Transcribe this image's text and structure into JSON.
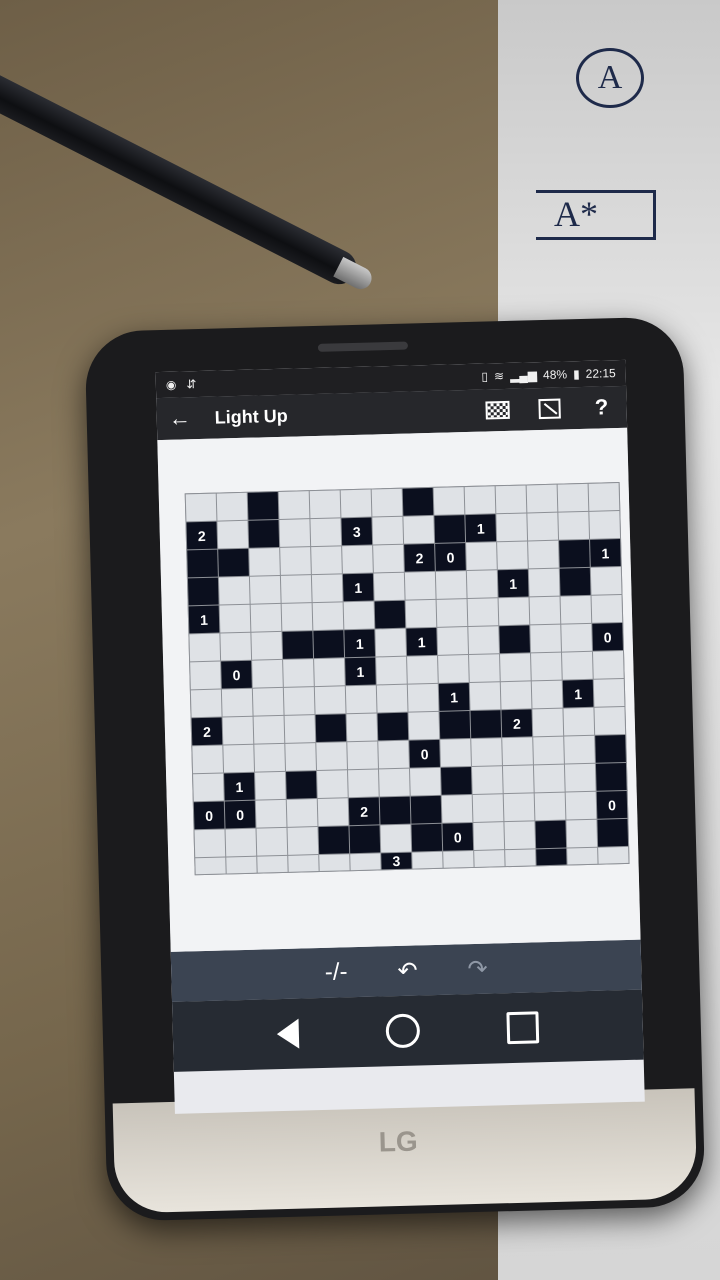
{
  "statusbar": {
    "battery": "48%",
    "time": "22:15"
  },
  "appbar": {
    "title": "Light Up"
  },
  "icons": {
    "back": "arrow-left-icon",
    "pattern": "checkerboard-icon",
    "resize": "resize-icon",
    "help": "help-icon",
    "mark": "mark-icon",
    "undo": "undo-icon",
    "redo": "redo-icon"
  },
  "toolbar": {
    "mark": "-/-",
    "undo": "↶",
    "redo": "↷"
  },
  "background": {
    "paper_top_label": "A",
    "paper_label": "A*"
  },
  "phone": {
    "brand": "LG"
  },
  "board": {
    "cols": 14,
    "rows": 13,
    "grid": [
      [
        ".",
        ".",
        "B",
        ".",
        ".",
        ".",
        ".",
        "B",
        ".",
        ".",
        ".",
        ".",
        ".",
        "."
      ],
      [
        "2",
        ".",
        "B",
        ".",
        ".",
        "3",
        ".",
        ".",
        "B",
        "1",
        ".",
        ".",
        ".",
        "."
      ],
      [
        "B",
        "B",
        ".",
        ".",
        ".",
        ".",
        ".",
        "2",
        "0",
        ".",
        ".",
        ".",
        "B",
        "1"
      ],
      [
        "B",
        ".",
        ".",
        ".",
        ".",
        "1",
        ".",
        ".",
        ".",
        ".",
        "1",
        ".",
        "B",
        "."
      ],
      [
        "1",
        ".",
        ".",
        ".",
        ".",
        ".",
        "B",
        ".",
        ".",
        ".",
        ".",
        ".",
        ".",
        "."
      ],
      [
        ".",
        ".",
        ".",
        "B",
        "B",
        "1",
        ".",
        "1",
        ".",
        ".",
        "B",
        ".",
        ".",
        "0"
      ],
      [
        ".",
        "0",
        ".",
        ".",
        ".",
        "1",
        ".",
        ".",
        ".",
        ".",
        ".",
        ".",
        ".",
        "."
      ],
      [
        ".",
        ".",
        ".",
        ".",
        ".",
        ".",
        ".",
        ".",
        "1",
        ".",
        ".",
        ".",
        "1",
        "."
      ],
      [
        "2",
        ".",
        ".",
        ".",
        "B",
        ".",
        "B",
        ".",
        "B",
        "B",
        "2",
        ".",
        ".",
        "."
      ],
      [
        ".",
        ".",
        ".",
        ".",
        ".",
        ".",
        ".",
        "0",
        ".",
        ".",
        ".",
        ".",
        ".",
        "B"
      ],
      [
        ".",
        "1",
        ".",
        "B",
        ".",
        ".",
        ".",
        ".",
        "B",
        ".",
        ".",
        ".",
        ".",
        "B"
      ],
      [
        "0",
        "0",
        ".",
        ".",
        ".",
        "2",
        "B",
        "B",
        ".",
        ".",
        ".",
        ".",
        ".",
        "0"
      ],
      [
        ".",
        ".",
        ".",
        ".",
        "B",
        "B",
        ".",
        "B",
        "0",
        ".",
        ".",
        "B",
        ".",
        "B"
      ],
      [
        ".",
        ".",
        ".",
        ".",
        ".",
        ".",
        "3",
        ".",
        ".",
        ".",
        ".",
        "B",
        ".",
        "."
      ]
    ]
  }
}
